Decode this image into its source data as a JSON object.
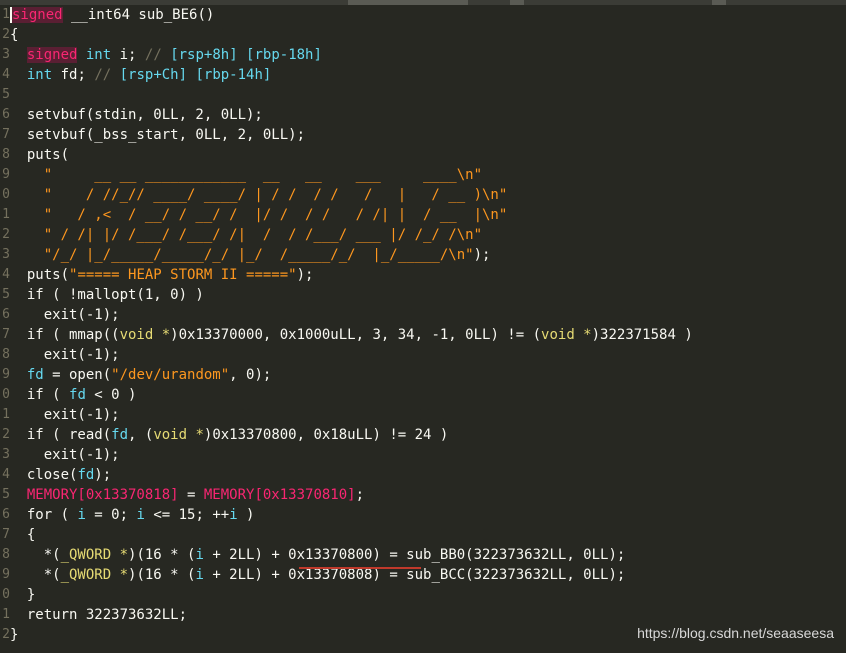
{
  "watermark": "https://blog.csdn.net/seaaseesa",
  "colors": {
    "background": "#272822",
    "keyword": "#f92672",
    "type": "#66d9ef",
    "comment": "#75715e",
    "string": "#e6db74",
    "ascii_art": "#fd971f",
    "memory_global": "#f92672",
    "highlight_underline": "#c0392b"
  },
  "line_numbers": [
    "1",
    "2",
    "3",
    "4",
    "5",
    "6",
    "7",
    "8",
    "9",
    "0",
    "1",
    "2",
    "3",
    "4",
    "5",
    "6",
    "7",
    "8",
    "9",
    "0",
    "1",
    "2",
    "3",
    "4",
    "5",
    "6",
    "7",
    "8",
    "9",
    "0",
    "1",
    "2"
  ],
  "lines": [
    [
      {
        "c": "t-signed",
        "t": "signed"
      },
      {
        "c": "t-pl",
        "t": " __int64 sub_BE6()"
      }
    ],
    [
      {
        "c": "t-pl",
        "t": "{"
      }
    ],
    [
      {
        "c": "t-pl",
        "t": "  "
      },
      {
        "c": "t-signed",
        "t": "signed"
      },
      {
        "c": "t-pl",
        "t": " "
      },
      {
        "c": "t-type",
        "t": "int"
      },
      {
        "c": "t-pl",
        "t": " i; "
      },
      {
        "c": "t-cmt",
        "t": "// "
      },
      {
        "c": "t-reg",
        "t": "[rsp+8h] [rbp-18h]"
      }
    ],
    [
      {
        "c": "t-pl",
        "t": "  "
      },
      {
        "c": "t-type",
        "t": "int"
      },
      {
        "c": "t-pl",
        "t": " fd; "
      },
      {
        "c": "t-cmt",
        "t": "// "
      },
      {
        "c": "t-reg",
        "t": "[rsp+Ch] [rbp-14h]"
      }
    ],
    [
      {
        "c": "t-pl",
        "t": ""
      }
    ],
    [
      {
        "c": "t-pl",
        "t": "  setvbuf(stdin, 0LL, 2, 0LL);"
      }
    ],
    [
      {
        "c": "t-pl",
        "t": "  setvbuf(_bss_start, 0LL, 2, 0LL);"
      }
    ],
    [
      {
        "c": "t-pl",
        "t": "  puts("
      }
    ],
    [
      {
        "c": "t-asc",
        "t": "    \"     __ __ ____________  __   __    ___     ____\\n\""
      }
    ],
    [
      {
        "c": "t-asc",
        "t": "    \"    / //_// ____/ ____/ | / /  / /   /   |   / __ )\\n\""
      }
    ],
    [
      {
        "c": "t-asc",
        "t": "    \"   / ,<  / __/ / __/ /  |/ /  / /   / /| |  / __  |\\n\""
      }
    ],
    [
      {
        "c": "t-asc",
        "t": "    \" / /| |/ /___/ /___/ /|  /  / /___/ ___ |/ /_/ /\\n\""
      }
    ],
    [
      {
        "c": "t-asc",
        "t": "    \"/_/ |_/_____/_____/_/ |_/  /_____/_/  |_/_____/\\n\""
      },
      {
        "c": "t-pl",
        "t": ");"
      }
    ],
    [
      {
        "c": "t-pl",
        "t": "  puts("
      },
      {
        "c": "t-asc",
        "t": "\"===== HEAP STORM II =====\""
      },
      {
        "c": "t-pl",
        "t": ");"
      }
    ],
    [
      {
        "c": "t-pl",
        "t": "  if ( !mallopt(1, 0) )"
      }
    ],
    [
      {
        "c": "t-pl",
        "t": "    exit(-1);"
      }
    ],
    [
      {
        "c": "t-pl",
        "t": "  if ( mmap(("
      },
      {
        "c": "t-cast",
        "t": "void *"
      },
      {
        "c": "t-pl",
        "t": ")0x13370000, 0x1000uLL, 3, 34, -1, 0LL) != ("
      },
      {
        "c": "t-cast",
        "t": "void *"
      },
      {
        "c": "t-pl",
        "t": ")322371584 )"
      }
    ],
    [
      {
        "c": "t-pl",
        "t": "    exit(-1);"
      }
    ],
    [
      {
        "c": "t-pl",
        "t": "  "
      },
      {
        "c": "t-var",
        "t": "fd"
      },
      {
        "c": "t-pl",
        "t": " = open("
      },
      {
        "c": "t-asc",
        "t": "\"/dev/urandom\""
      },
      {
        "c": "t-pl",
        "t": ", 0);"
      }
    ],
    [
      {
        "c": "t-pl",
        "t": "  if ( "
      },
      {
        "c": "t-var",
        "t": "fd"
      },
      {
        "c": "t-pl",
        "t": " < 0 )"
      }
    ],
    [
      {
        "c": "t-pl",
        "t": "    exit(-1);"
      }
    ],
    [
      {
        "c": "t-pl",
        "t": "  if ( read("
      },
      {
        "c": "t-var",
        "t": "fd"
      },
      {
        "c": "t-pl",
        "t": ", ("
      },
      {
        "c": "t-cast",
        "t": "void *"
      },
      {
        "c": "t-pl",
        "t": ")0x13370800, 0x18uLL) != 24 )"
      }
    ],
    [
      {
        "c": "t-pl",
        "t": "    exit(-1);"
      }
    ],
    [
      {
        "c": "t-pl",
        "t": "  close("
      },
      {
        "c": "t-var",
        "t": "fd"
      },
      {
        "c": "t-pl",
        "t": ");"
      }
    ],
    [
      {
        "c": "t-pl",
        "t": "  "
      },
      {
        "c": "t-mem",
        "t": "MEMORY[0x13370818]"
      },
      {
        "c": "t-pl",
        "t": " = "
      },
      {
        "c": "t-mem",
        "t": "MEMORY[0x13370810]"
      },
      {
        "c": "t-pl",
        "t": ";"
      }
    ],
    [
      {
        "c": "t-pl",
        "t": "  for ( "
      },
      {
        "c": "t-var",
        "t": "i"
      },
      {
        "c": "t-pl",
        "t": " = 0; "
      },
      {
        "c": "t-var",
        "t": "i"
      },
      {
        "c": "t-pl",
        "t": " <= 15; ++"
      },
      {
        "c": "t-var",
        "t": "i"
      },
      {
        "c": "t-pl",
        "t": " )"
      }
    ],
    [
      {
        "c": "t-pl",
        "t": "  {"
      }
    ],
    [
      {
        "c": "t-pl",
        "t": "    *("
      },
      {
        "c": "t-cast",
        "t": "_QWORD *"
      },
      {
        "c": "t-pl",
        "t": ")(16 * ("
      },
      {
        "c": "t-var",
        "t": "i"
      },
      {
        "c": "t-pl",
        "t": " + 2LL) + 0x13370800) = sub_BB0(322373632LL, 0LL);"
      }
    ],
    [
      {
        "c": "t-pl",
        "t": "    *("
      },
      {
        "c": "t-cast",
        "t": "_QWORD *"
      },
      {
        "c": "t-pl",
        "t": ")(16 * ("
      },
      {
        "c": "t-var",
        "t": "i"
      },
      {
        "c": "t-pl",
        "t": " + 2LL) + 0x13370808) = sub_BCC(322373632LL, 0LL);"
      }
    ],
    [
      {
        "c": "t-pl",
        "t": "  }"
      }
    ],
    [
      {
        "c": "t-pl",
        "t": "  return 322373632LL;"
      }
    ],
    [
      {
        "c": "t-pl",
        "t": "}"
      }
    ]
  ]
}
